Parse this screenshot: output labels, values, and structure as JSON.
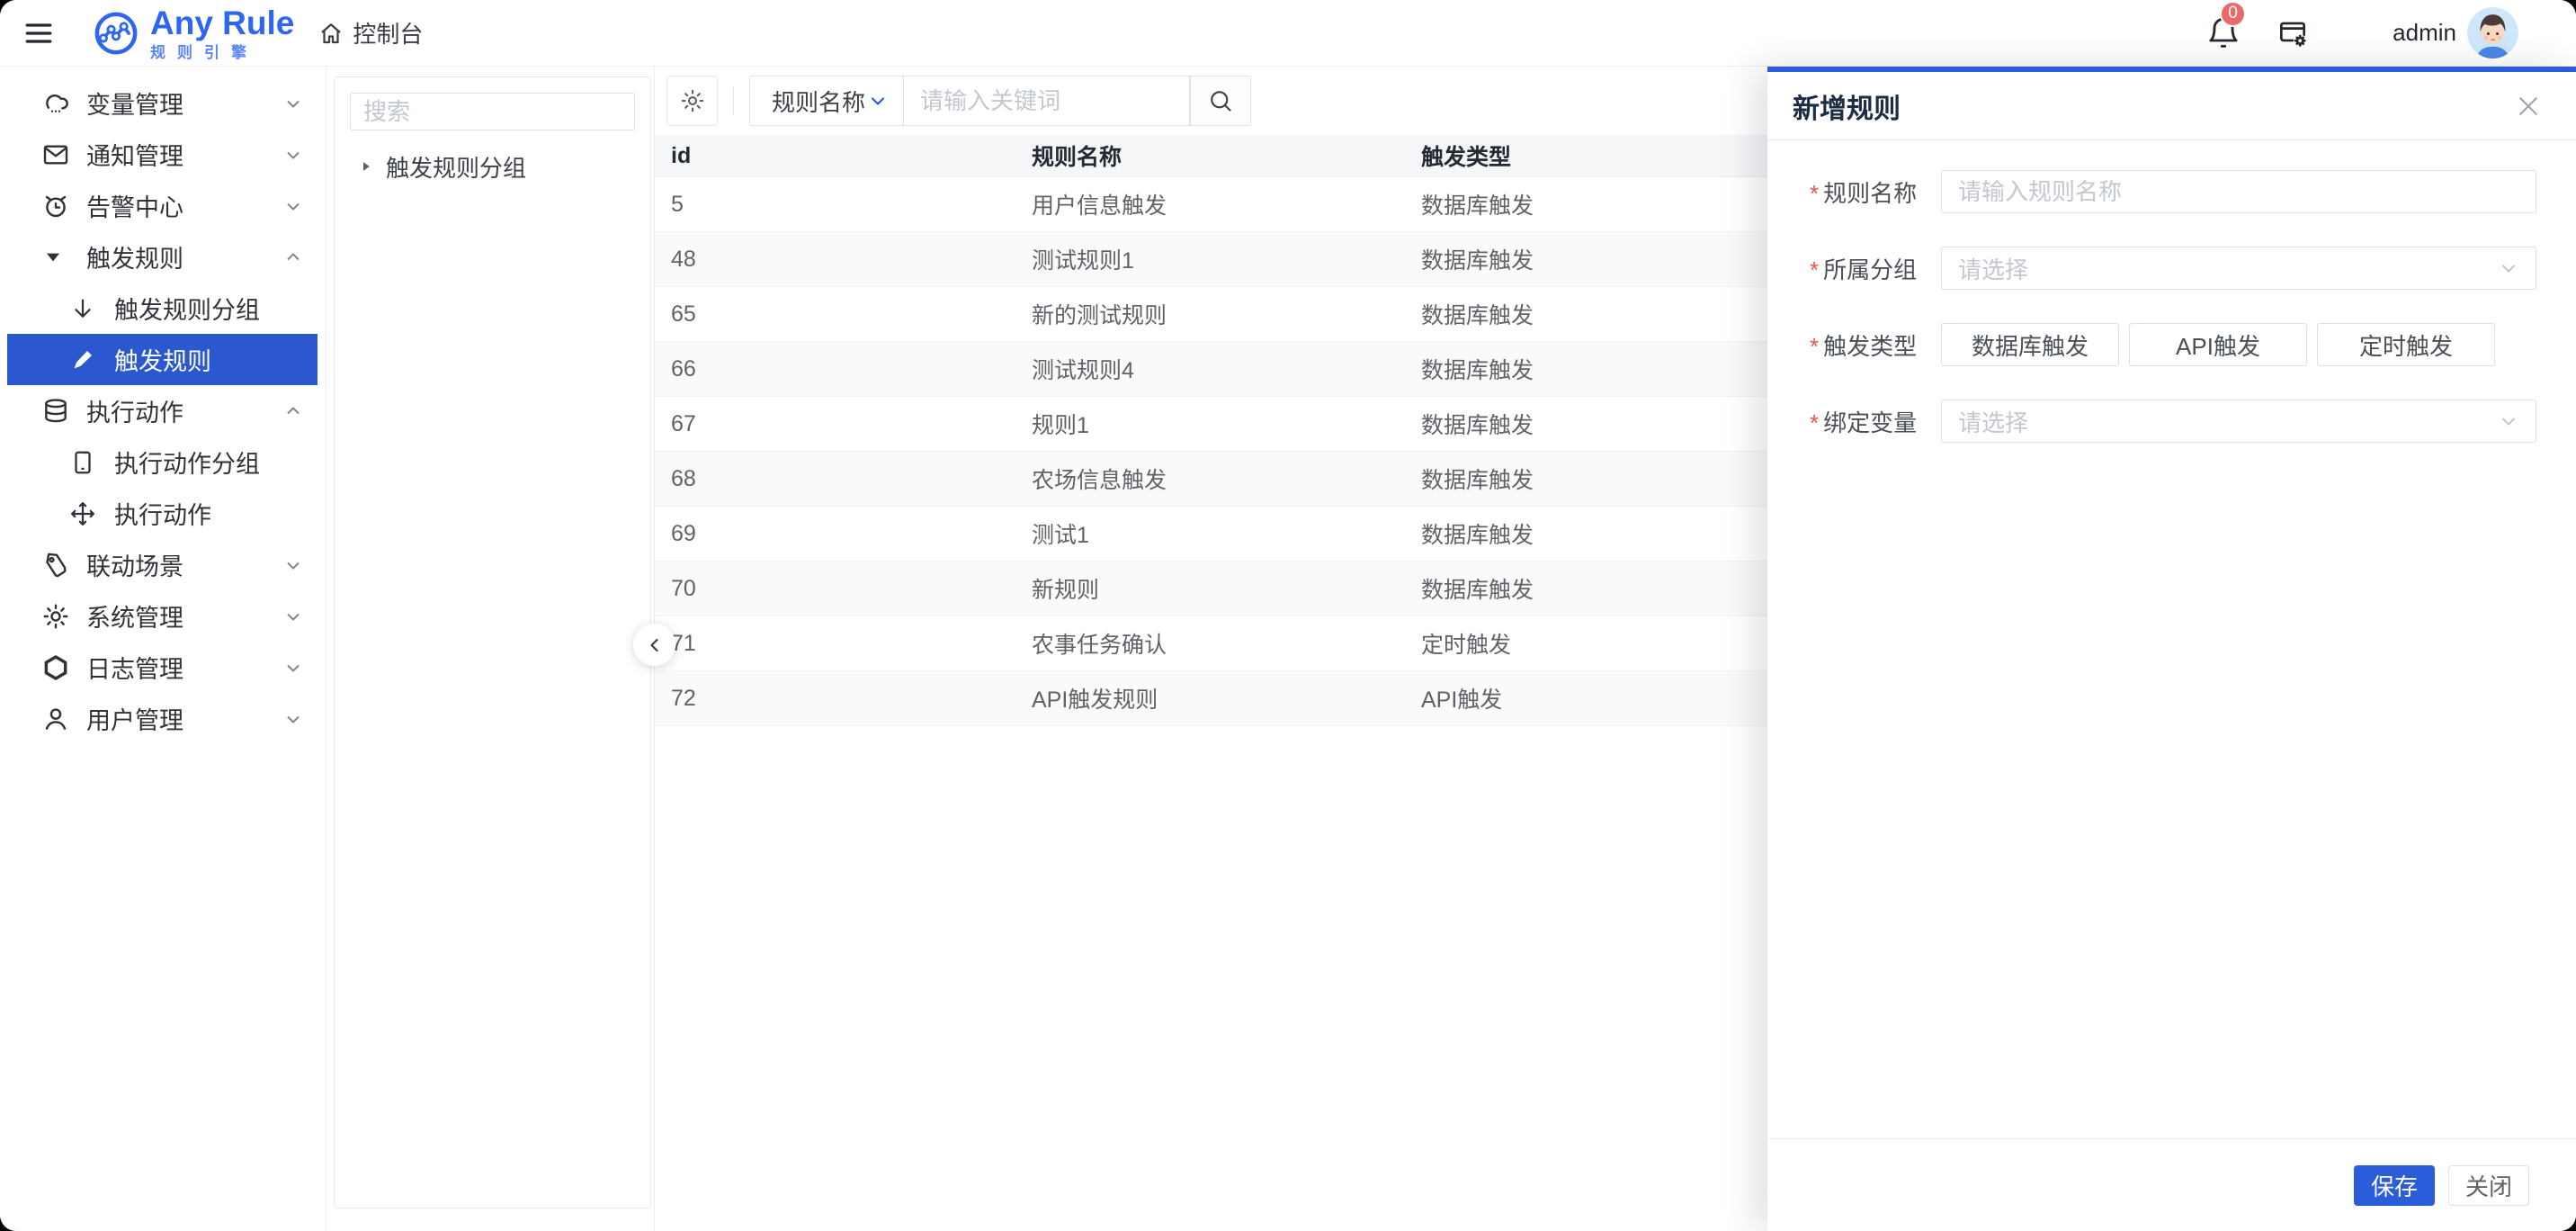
{
  "colors": {
    "primary": "#2b5cd9",
    "badge": "#e96a6a",
    "logo_blue": "#2f66f0"
  },
  "header": {
    "brand": "Any Rule",
    "brand_sub": "规则引擎",
    "breadcrumb": "控制台",
    "badge_count": "0",
    "username": "admin"
  },
  "sidebar": {
    "items": [
      {
        "label": "变量管理",
        "icon": "cloud-icon"
      },
      {
        "label": "通知管理",
        "icon": "mail-icon"
      },
      {
        "label": "告警中心",
        "icon": "alarm-icon"
      },
      {
        "label": "触发规则",
        "icon": "caret-down-filled-icon",
        "expanded": true
      },
      {
        "label": "触发规则分组",
        "icon": "arrow-down-icon",
        "sub": true
      },
      {
        "label": "触发规则",
        "icon": "pen-icon",
        "sub": true,
        "active": true
      },
      {
        "label": "执行动作",
        "icon": "database-icon",
        "expanded": true
      },
      {
        "label": "执行动作分组",
        "icon": "tablet-icon",
        "sub": true
      },
      {
        "label": "执行动作",
        "icon": "move-icon",
        "sub": true
      },
      {
        "label": "联动场景",
        "icon": "tag-icon"
      },
      {
        "label": "系统管理",
        "icon": "gear-icon"
      },
      {
        "label": "日志管理",
        "icon": "hexagon-icon"
      },
      {
        "label": "用户管理",
        "icon": "user-icon"
      }
    ]
  },
  "tree": {
    "search_placeholder": "搜索",
    "node_label": "触发规则分组"
  },
  "toolbar": {
    "filter_value": "规则名称",
    "keyword_placeholder": "请输入关键词"
  },
  "table": {
    "columns": [
      "id",
      "规则名称",
      "触发类型"
    ],
    "rows": [
      [
        "5",
        "用户信息触发",
        "数据库触发"
      ],
      [
        "48",
        "测试规则1",
        "数据库触发"
      ],
      [
        "65",
        "新的测试规则",
        "数据库触发"
      ],
      [
        "66",
        "测试规则4",
        "数据库触发"
      ],
      [
        "67",
        "规则1",
        "数据库触发"
      ],
      [
        "68",
        "农场信息触发",
        "数据库触发"
      ],
      [
        "69",
        "测试1",
        "数据库触发"
      ],
      [
        "70",
        "新规则",
        "数据库触发"
      ],
      [
        "71",
        "农事任务确认",
        "定时触发"
      ],
      [
        "72",
        "API触发规则",
        "API触发"
      ]
    ]
  },
  "drawer": {
    "title": "新增规则",
    "required_mark": "*",
    "fields": {
      "name_label": "规则名称",
      "name_placeholder": "请输入规则名称",
      "group_label": "所属分组",
      "group_placeholder": "请选择",
      "trigger_label": "触发类型",
      "var_label": "绑定变量",
      "var_placeholder": "请选择"
    },
    "trigger_buttons": [
      "数据库触发",
      "API触发",
      "定时触发"
    ],
    "save_label": "保存",
    "close_label": "关闭"
  }
}
